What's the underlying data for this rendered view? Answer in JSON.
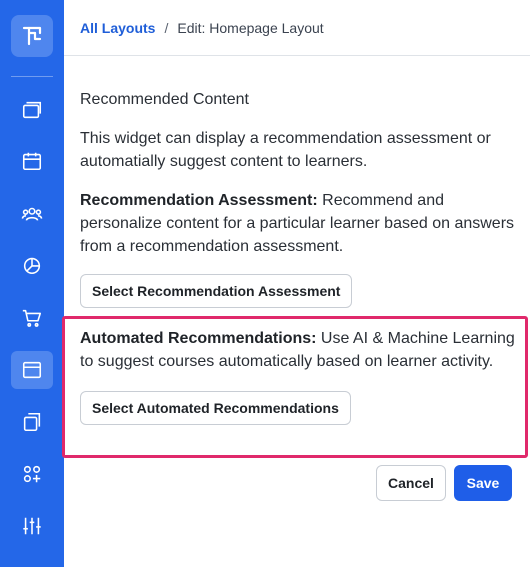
{
  "breadcrumb": {
    "link": "All Layouts",
    "separator": "/",
    "current": "Edit: Homepage Layout"
  },
  "sidebar": {
    "logo": "logo-icon",
    "items": [
      {
        "icon": "courses-icon",
        "active": false
      },
      {
        "icon": "calendar-icon",
        "active": false
      },
      {
        "icon": "users-icon",
        "active": false
      },
      {
        "icon": "reports-icon",
        "active": false
      },
      {
        "icon": "cart-icon",
        "active": false
      },
      {
        "icon": "layout-icon",
        "active": true
      },
      {
        "icon": "pages-icon",
        "active": false
      },
      {
        "icon": "apps-icon",
        "active": false
      },
      {
        "icon": "settings-sliders-icon",
        "active": false
      }
    ]
  },
  "widget": {
    "title": "Recommended Content",
    "description": "This widget can display a recommendation assessment or automatially suggest content to learners.",
    "assessment_heading": "Recommendation Assessment:",
    "assessment_text": " Recommend and personalize content for a particular learner based on answers from a recommendation assessment.",
    "assessment_button": "Select Recommendation Assessment",
    "automated_heading": "Automated Recommendations:",
    "automated_text": " Use AI & Machine Learning to suggest courses automatically based on learner activity.",
    "automated_button": "Select Automated Recommendations"
  },
  "footer": {
    "cancel": "Cancel",
    "save": "Save"
  },
  "colors": {
    "sidebar": "#2467e8",
    "accent": "#1f5ee8",
    "highlight": "#e0296b"
  }
}
